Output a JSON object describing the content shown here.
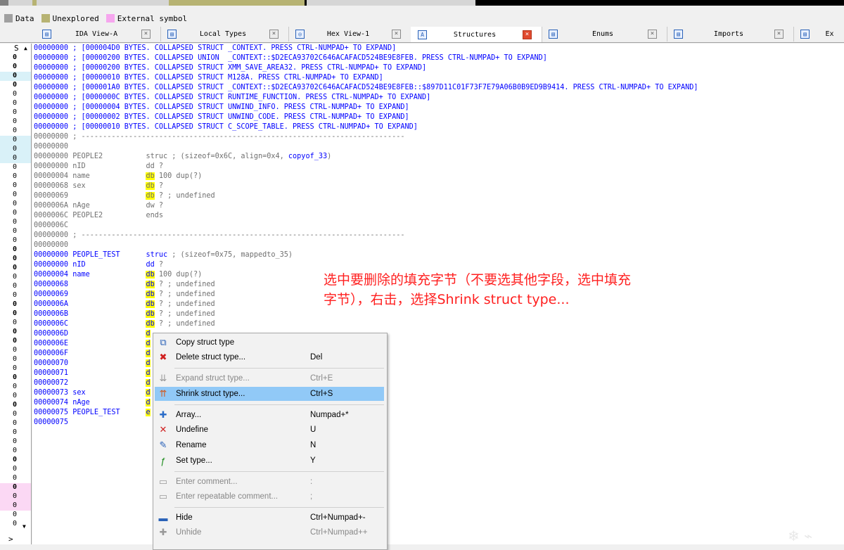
{
  "legend": [
    {
      "label": "Data",
      "color": "#a0a0a0"
    },
    {
      "label": "Unexplored",
      "color": "#b7b373"
    },
    {
      "label": "External symbol",
      "color": "#f6a6ee"
    }
  ],
  "window_controls": {
    "restore": "🗗",
    "close": "×"
  },
  "tabs": [
    {
      "label": "IDA View-A",
      "close": "×"
    },
    {
      "label": "Local Types",
      "close": "×"
    },
    {
      "label": "Hex View-1",
      "close": "×"
    },
    {
      "label": "Structures",
      "close": "×"
    },
    {
      "label": "Enums",
      "close": "×"
    },
    {
      "label": "Imports",
      "close": "×"
    },
    {
      "label": "Ex",
      "close": ""
    }
  ],
  "left_panel": {
    "header": "S",
    "rows": [
      "0",
      "0",
      "0",
      "0",
      "0",
      "0",
      "0",
      "0",
      "0",
      "0",
      "0",
      "0",
      "0",
      "0",
      "0",
      "0",
      "0",
      "0",
      "0",
      "0",
      "0",
      "0",
      "0",
      "0",
      "0",
      "0",
      "0",
      "0",
      "0",
      "0",
      "0",
      "0",
      "0",
      "0",
      "0",
      "0",
      "0",
      "0",
      "0",
      "0",
      "0",
      "0",
      "0",
      "0",
      "0",
      "0",
      "0",
      "0",
      "0",
      "0",
      "0",
      "0"
    ],
    "bottom": ">"
  },
  "collapsed": [
    {
      "addr": "00000000",
      "text": "; [000004D0 BYTES. COLLAPSED STRUCT _CONTEXT. PRESS CTRL-NUMPAD+ TO EXPAND]"
    },
    {
      "addr": "00000000",
      "text": "; [00000200 BYTES. COLLAPSED UNION  _CONTEXT::$D2ECA93702C646ACAFACD524BE9E8FEB. PRESS CTRL-NUMPAD+ TO EXPAND]"
    },
    {
      "addr": "00000000",
      "text": "; [00000200 BYTES. COLLAPSED STRUCT XMM_SAVE_AREA32. PRESS CTRL-NUMPAD+ TO EXPAND]"
    },
    {
      "addr": "00000000",
      "text": "; [00000010 BYTES. COLLAPSED STRUCT M128A. PRESS CTRL-NUMPAD+ TO EXPAND]"
    },
    {
      "addr": "00000000",
      "text": "; [000001A0 BYTES. COLLAPSED STRUCT _CONTEXT::$D2ECA93702C646ACAFACD524BE9E8FEB::$897D11C01F73F7E79A06B0B9ED9B9414. PRESS CTRL-NUMPAD+ TO EXPAND]"
    },
    {
      "addr": "00000000",
      "text": "; [0000000C BYTES. COLLAPSED STRUCT RUNTIME_FUNCTION. PRESS CTRL-NUMPAD+ TO EXPAND]"
    },
    {
      "addr": "00000000",
      "text": "; [00000004 BYTES. COLLAPSED STRUCT UNWIND_INFO. PRESS CTRL-NUMPAD+ TO EXPAND]"
    },
    {
      "addr": "00000000",
      "text": "; [00000002 BYTES. COLLAPSED STRUCT UNWIND_CODE. PRESS CTRL-NUMPAD+ TO EXPAND]"
    },
    {
      "addr": "00000000",
      "text": "; [00000010 BYTES. COLLAPSED STRUCT C_SCOPE_TABLE. PRESS CTRL-NUMPAD+ TO EXPAND]"
    }
  ],
  "separator": "; ---------------------------------------------------------------------------",
  "people2": {
    "sep_addr": "00000000",
    "blank_addr": "00000000",
    "rows": [
      {
        "addr": "00000000",
        "name": "PEOPLE2",
        "op": "struc",
        "rest": " ; (sizeof=0x6C, align=0x4, ",
        "link": "copyof_33",
        "tail": ")"
      },
      {
        "addr": "00000000",
        "name": "nID",
        "op": "dd",
        "rest": " ?",
        "link": "",
        "tail": ""
      },
      {
        "addr": "00000004",
        "name": "name",
        "op": "db",
        "rest": " 100 dup(?)",
        "link": "",
        "tail": ""
      },
      {
        "addr": "00000068",
        "name": "sex",
        "op": "db",
        "rest": " ?",
        "link": "",
        "tail": ""
      },
      {
        "addr": "00000069",
        "name": "",
        "op": "db",
        "rest": " ? ; undefined",
        "link": "",
        "tail": ""
      },
      {
        "addr": "0000006A",
        "name": "nAge",
        "op": "dw",
        "rest": " ?",
        "link": "",
        "tail": ""
      },
      {
        "addr": "0000006C",
        "name": "PEOPLE2",
        "op": "ends",
        "rest": "",
        "link": "",
        "tail": ""
      },
      {
        "addr": "0000006C",
        "name": "",
        "op": "",
        "rest": "",
        "link": "",
        "tail": ""
      }
    ]
  },
  "people_test": {
    "sep_addr": "00000000",
    "blank_addr": "00000000",
    "rows": [
      {
        "addr": "00000000",
        "name": "PEOPLE_TEST",
        "op": "struc",
        "rest": " ; (sizeof=0x75, mappedto_35)"
      },
      {
        "addr": "00000000",
        "name": "nID",
        "op": "dd",
        "rest": " ?"
      },
      {
        "addr": "00000004",
        "name": "name",
        "op": "db",
        "rest": " 100 dup(?)"
      },
      {
        "addr": "00000068",
        "name": "",
        "op": "db",
        "rest": " ? ; undefined"
      },
      {
        "addr": "00000069",
        "name": "",
        "op": "db",
        "rest": " ? ; undefined"
      },
      {
        "addr": "0000006A",
        "name": "",
        "op": "db",
        "rest": " ? ; undefined"
      },
      {
        "addr": "0000006B",
        "name": "",
        "op": "db",
        "rest": " ? ; undefined"
      },
      {
        "addr": "0000006C",
        "name": "",
        "op": "db",
        "rest": " ? ; undefined"
      },
      {
        "addr": "0000006D",
        "name": "",
        "op": "d",
        "rest": ""
      },
      {
        "addr": "0000006E",
        "name": "",
        "op": "d",
        "rest": ""
      },
      {
        "addr": "0000006F",
        "name": "",
        "op": "d",
        "rest": ""
      },
      {
        "addr": "00000070",
        "name": "",
        "op": "d",
        "rest": ""
      },
      {
        "addr": "00000071",
        "name": "",
        "op": "d",
        "rest": ""
      },
      {
        "addr": "00000072",
        "name": "",
        "op": "d",
        "rest": ""
      },
      {
        "addr": "00000073",
        "name": "sex",
        "op": "d",
        "rest": ""
      },
      {
        "addr": "00000074",
        "name": "nAge",
        "op": "d",
        "rest": ""
      },
      {
        "addr": "00000075",
        "name": "PEOPLE_TEST",
        "op": "e",
        "rest": ""
      },
      {
        "addr": "00000075",
        "name": "",
        "op": "",
        "rest": ""
      }
    ]
  },
  "annotation": {
    "line1": "选中要删除的填充字节（不要选其他字段，选中填充",
    "line2": "字节），右击，选择Shrink struct type..."
  },
  "context_menu": [
    {
      "icon": "copy-struct-icon",
      "label": "Copy struct type",
      "shortcut": "",
      "disabled": false,
      "selected": false
    },
    {
      "icon": "delete-struct-icon",
      "label": "Delete struct type...",
      "shortcut": "Del",
      "disabled": false,
      "selected": false
    },
    {
      "icon": "expand-struct-icon",
      "label": "Expand struct type...",
      "shortcut": "Ctrl+E",
      "disabled": true,
      "selected": false
    },
    {
      "icon": "shrink-struct-icon",
      "label": "Shrink struct type...",
      "shortcut": "Ctrl+S",
      "disabled": false,
      "selected": true
    },
    {
      "icon": "array-icon",
      "label": "Array...",
      "shortcut": "Numpad+*",
      "disabled": false,
      "selected": false
    },
    {
      "icon": "undefine-icon",
      "label": "Undefine",
      "shortcut": "U",
      "disabled": false,
      "selected": false
    },
    {
      "icon": "rename-icon",
      "label": "Rename",
      "shortcut": "N",
      "disabled": false,
      "selected": false
    },
    {
      "icon": "set-type-icon",
      "label": "Set type...",
      "shortcut": "Y",
      "disabled": false,
      "selected": false
    },
    {
      "icon": "comment-icon",
      "label": "Enter comment...",
      "shortcut": ":",
      "disabled": true,
      "selected": false
    },
    {
      "icon": "repeatable-comment-icon",
      "label": "Enter repeatable comment...",
      "shortcut": ";",
      "disabled": true,
      "selected": false
    },
    {
      "icon": "hide-icon",
      "label": "Hide",
      "shortcut": "Ctrl+Numpad+-",
      "disabled": false,
      "selected": false
    },
    {
      "icon": "unhide-icon",
      "label": "Unhide",
      "shortcut": "Ctrl+Numpad++",
      "disabled": true,
      "selected": false
    }
  ],
  "colors": {
    "accent_blue": "#0000ff",
    "highlight_yellow": "#ffff00",
    "annotation_red": "#ff2020",
    "menu_selected": "#91c9f7"
  }
}
